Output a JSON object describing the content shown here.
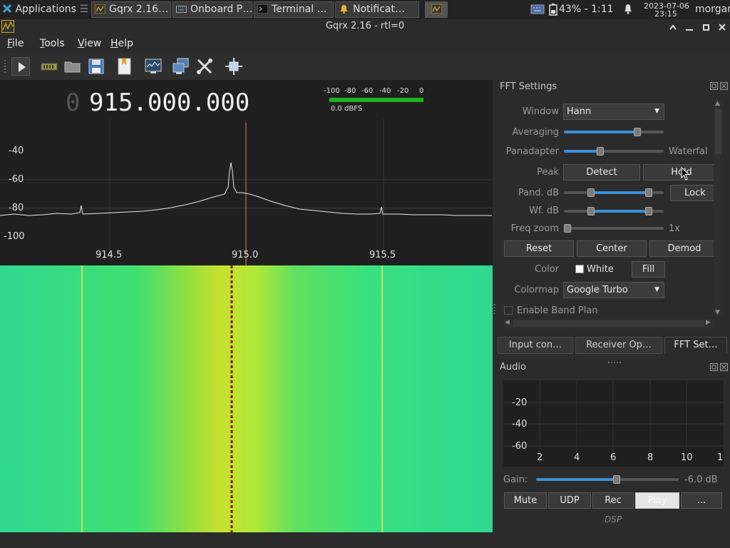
{
  "taskbar": {
    "items": [
      {
        "label": "Applications"
      },
      {
        "label": "Gqrx 2.16…"
      },
      {
        "label": "Onboard P…"
      },
      {
        "label": "Terminal …"
      },
      {
        "label": "Notificat…"
      }
    ],
    "battery": "43% - 1:11",
    "date": "2023-07-06",
    "time": "23:15",
    "user": "morgan"
  },
  "window": {
    "title": "Gqrx 2.16 - rtl=0"
  },
  "menu": {
    "file": "File",
    "tools": "Tools",
    "view": "View",
    "help": "Help"
  },
  "frequency": {
    "prefix": "0",
    "value": "915.000.000"
  },
  "meter": {
    "scale": [
      "-100",
      "-80",
      "-60",
      "-40",
      "-20",
      "0"
    ],
    "readout": "0.0 dBFS"
  },
  "spectrum": {
    "y_labels": [
      "-40",
      "-60",
      "-80",
      "-100"
    ],
    "x_labels": [
      "914.5",
      "915.0",
      "915.5"
    ]
  },
  "fft": {
    "title": "FFT Settings",
    "window_label": "Window",
    "window_value": "Hann",
    "averaging_label": "Averaging",
    "averaging_value": 0.74,
    "panadapter_label": "Panadapter",
    "waterfall_label": "Waterfal",
    "pan_split": 0.37,
    "peak_label": "Peak",
    "detect": "Detect",
    "hold": "Hold",
    "pand_db_label": "Pand. dB",
    "wf_db_label": "Wf. dB",
    "lock": "Lock",
    "freq_zoom_label": "Freq zoom",
    "freq_zoom_value": "1x",
    "reset": "Reset",
    "center": "Center",
    "demod": "Demod",
    "color_label": "Color",
    "white": "White",
    "fill": "Fill",
    "colormap_label": "Colormap",
    "colormap_value": "Google Turbo",
    "band_plan": "Enable Band Plan"
  },
  "tabs": [
    "Input con…",
    "Receiver Op…",
    "FFT Set…"
  ],
  "audio": {
    "title": "Audio",
    "y_labels": [
      "-20",
      "-40",
      "-60"
    ],
    "x_labels": [
      "2",
      "4",
      "6",
      "8",
      "10",
      "1"
    ],
    "gain_label": "Gain:",
    "gain_value": "-6.0 dB",
    "gain_level": 0.56,
    "buttons": [
      "Mute",
      "UDP",
      "Rec",
      "Play",
      "..."
    ],
    "dsp": "DSP"
  }
}
